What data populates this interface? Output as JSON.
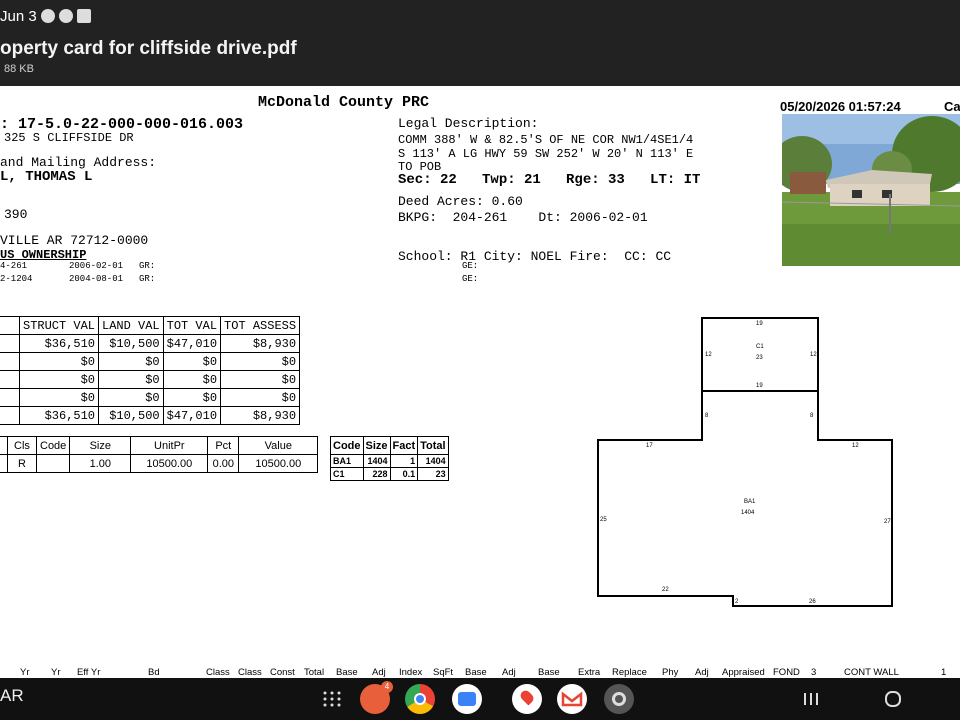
{
  "status_bar": {
    "time": "Jun 3"
  },
  "file_header": {
    "title": "operty card for cliffside drive.pdf",
    "size": "88 KB"
  },
  "document": {
    "title": "McDonald County PRC",
    "datetime": "05/20/2026 01:57:24",
    "corner_label": "Ca",
    "parcel_id": ": 17-5.0-22-000-000-016.003",
    "situs_address": "325 S CLIFFSIDE DR",
    "mailing_label": "and Mailing Address:",
    "owner_name": "L, THOMAS L",
    "address_line": "390",
    "city_state_zip": "VILLE AR 72712-0000",
    "ownership_heading": "US OWNERSHIP",
    "ownership_rows": [
      {
        "book": "4-261",
        "date": "2006-02-01",
        "gr": "GR:",
        "ge": "GE:"
      },
      {
        "book": "2-1204",
        "date": "2004-08-01",
        "gr": "GR:",
        "ge": "GE:"
      }
    ],
    "legal_label": "Legal Description:",
    "legal_line1": "COMM 388' W & 82.5'S OF NE COR NW1/4SE1/4",
    "legal_line2": "S 113' A LG HWY 59 SW 252' W 20' N 113' E",
    "legal_line3": "TO POB",
    "sec_line": "Sec: 22   Twp: 21   Rge: 33   LT: IT",
    "deed_acres": "Deed Acres: 0.60",
    "bkpg": "BKPG:  204-261    Dt: 2006-02-01",
    "school_line": "School: R1 City: NOEL Fire:  CC: CC"
  },
  "valuation_table": {
    "headers": [
      "STRUCT VAL",
      "LAND VAL",
      "TOT VAL",
      "TOT ASSESS"
    ],
    "rows": [
      [
        "$36,510",
        "$10,500",
        "$47,010",
        "$8,930"
      ],
      [
        "$0",
        "$0",
        "$0",
        "$0"
      ],
      [
        "$0",
        "$0",
        "$0",
        "$0"
      ],
      [
        "$0",
        "$0",
        "$0",
        "$0"
      ],
      [
        "$36,510",
        "$10,500",
        "$47,010",
        "$8,930"
      ]
    ]
  },
  "land_table": {
    "headers": [
      "Cls",
      "Code",
      "Size",
      "UnitPr",
      "Pct",
      "Value"
    ],
    "row": [
      "R",
      "",
      "1.00",
      "10500.00",
      "0.00",
      "10500.00"
    ]
  },
  "area_table": {
    "headers": [
      "Code",
      "Size",
      "Fact",
      "Total"
    ],
    "rows": [
      [
        "BA1",
        "1404",
        "1",
        "1404"
      ],
      [
        "C1",
        "228",
        "0.1",
        "23"
      ]
    ]
  },
  "sketch": {
    "labels": {
      "top_19": "19",
      "c1_label": "C1",
      "c1_area": "23",
      "left_12": "12",
      "right_12": "12",
      "bottom_19": "19",
      "left_8": "8",
      "right_8": "8",
      "dim_17": "17",
      "dim_12b": "12",
      "ba1_label": "BA1",
      "ba1_area": "1404",
      "dim_25": "25",
      "dim_27": "27",
      "dim_22": "22",
      "dim_2": "2",
      "dim_26": "26"
    }
  },
  "bottom_headers": [
    "Yr",
    "Yr",
    "Eff Yr",
    "Bd",
    "Class",
    "Class",
    "Const",
    "Total",
    "Base",
    "Adj",
    "Index",
    "SqFt",
    "Base",
    "Adj",
    "Base",
    "Extra",
    "Replace",
    "Phy",
    "Adj",
    "Appraised",
    "FOND",
    "3",
    "CONT WALL",
    "1"
  ],
  "nav": {
    "left_text": "AR",
    "badge_count": "4"
  },
  "colors": {
    "status_bg": "#222222",
    "nav_bg": "#111111"
  }
}
